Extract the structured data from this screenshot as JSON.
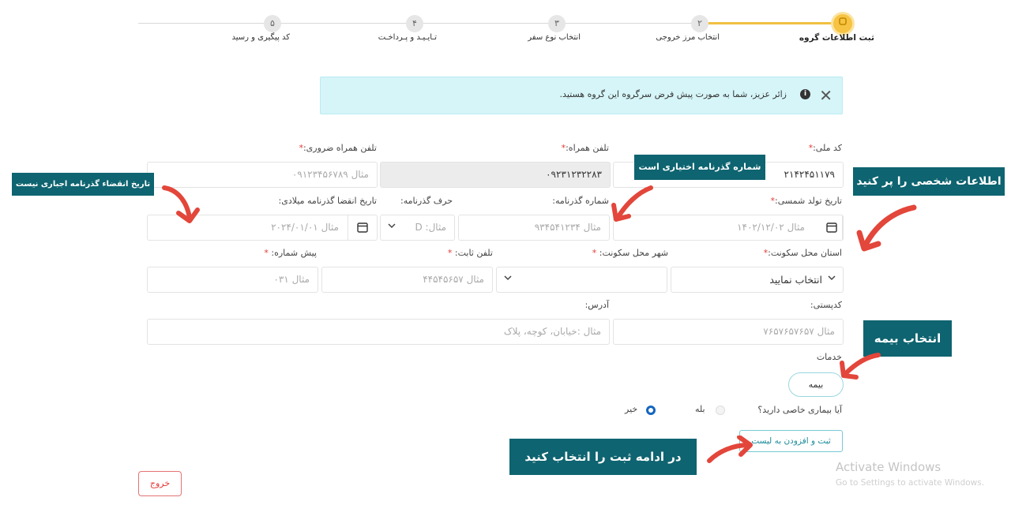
{
  "stepper": {
    "steps": [
      {
        "number": "",
        "label": "ثبت اطلاعات گروه",
        "active": true
      },
      {
        "number": "۲",
        "label": "انتخاب مرز خروجی",
        "active": false
      },
      {
        "number": "۳",
        "label": "انتخاب نوع سفر",
        "active": false
      },
      {
        "number": "۴",
        "label": "تـایـیـد و پـرداخـت",
        "active": false
      },
      {
        "number": "۵",
        "label": "کد پیگیری و رسید",
        "active": false
      }
    ]
  },
  "alert": {
    "text": "زائر عزیز، شما به صورت پیش فرض سرگروه این گروه هستید.",
    "info_symbol": "i",
    "close_symbol": "✕"
  },
  "form": {
    "national_code": {
      "label": "کد ملی:",
      "value": "۲۱۴۲۴۵۱۱۷۹"
    },
    "mobile": {
      "label": "تلفن همراه:",
      "value": "۰۹۲۳۱۲۳۲۲۸۳"
    },
    "emergency_mobile": {
      "label": "تلفن همراه ضروری:",
      "placeholder": "مثال ۰۹۱۲۳۴۵۶۷۸۹"
    },
    "birth_date": {
      "label": "تاریخ تولد شمسی:",
      "placeholder": "مثال ۱۴۰۲/۱۲/۰۲"
    },
    "passport_number": {
      "label": "شماره گذرنامه:",
      "placeholder": "مثال ۹۳۴۵۴۱۲۳۴"
    },
    "passport_letter": {
      "label": "حرف گذرنامه:",
      "placeholder": "مثال: D"
    },
    "passport_expiry": {
      "label": "تاریخ انقضا گذرنامه میلادی:",
      "placeholder": "مثال ۲۰۲۴/۰۱/۰۱"
    },
    "province": {
      "label": "استان محل سکونت:",
      "value": "انتخاب نمایید"
    },
    "city": {
      "label": "شهر محل سکونت:",
      "value": ""
    },
    "landline": {
      "label": "تلفن ثابت:",
      "placeholder": "مثال ۴۴۵۴۵۶۵۷"
    },
    "area_code": {
      "label": "پیش شماره:",
      "placeholder": "مثال ۰۳۱"
    },
    "postal_code": {
      "label": "کدپستی:",
      "placeholder": "مثال ۷۶۵۷۶۵۷۶۵۷"
    },
    "address": {
      "label": "آدرس:",
      "placeholder": "مثال :خیابان، کوچه، پلاک"
    },
    "services_label": "خدمات",
    "insurance_button": "بیمه",
    "disease_question": "آیا بیماری خاصی دارید؟",
    "disease_yes": "بله",
    "disease_no": "خیر",
    "disease_selected": "no",
    "save_button": "ثبت و افزودن به لیست",
    "exit_button": "خروج"
  },
  "annotations": {
    "personal_info": "اطلاعات شخصی را پر کنید",
    "passport_optional": "شماره گذرنامه اختیاری است",
    "expiry_optional": "تاریخ انقضاء گذرنامه اجباری نیست",
    "select_insurance": "انتخاب بیمه",
    "then_save": "در ادامه ثبت را انتخاب کنید"
  },
  "watermark": {
    "line1": "Activate Windows",
    "line2": "Go to Settings to activate Windows."
  },
  "colors": {
    "accent_yellow": "#f6c342",
    "callout_bg": "#0e6470",
    "alert_bg": "#d6f5f8",
    "required": "#e53935",
    "arrow_red": "#e3463a"
  }
}
